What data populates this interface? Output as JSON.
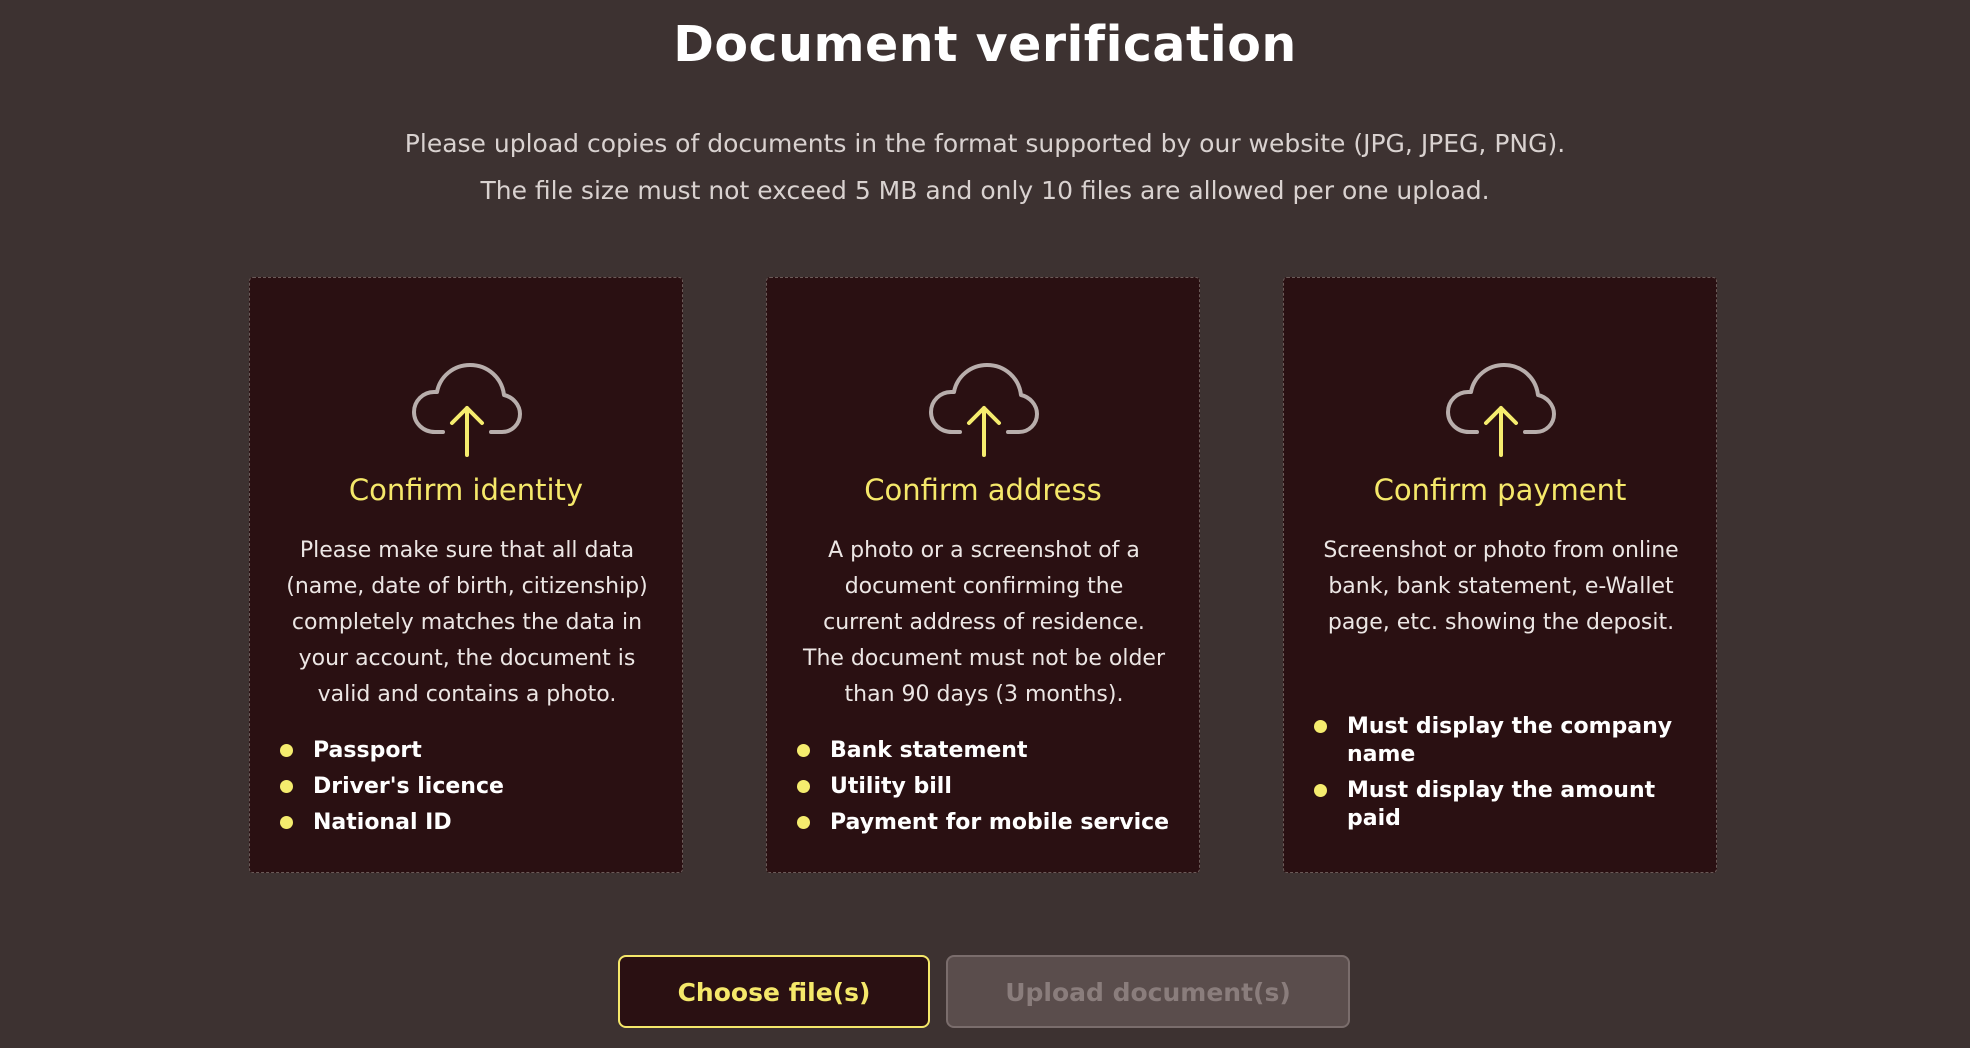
{
  "page": {
    "title": "Document verification",
    "intro_lines": [
      "Please upload copies of documents in the format supported by our website (JPG, JPEG, PNG).",
      "The file size must not exceed 5 MB and only 10 files are allowed per one upload."
    ]
  },
  "cards": [
    {
      "icon": "cloud-upload-icon",
      "title": "Confirm identity",
      "desc_lines": [
        "Please make sure that all data",
        "(name, date of birth, citizenship)",
        "completely matches the data in",
        "your account, the document is",
        "valid and contains a photo."
      ],
      "bullets": [
        "Passport",
        "Driver's licence",
        "National ID"
      ]
    },
    {
      "icon": "cloud-upload-icon",
      "title": "Confirm address",
      "desc_lines": [
        "A photo or a screenshot of a",
        "document confirming the",
        "current address of residence.",
        "The document must not be older",
        "than 90 days (3 months)."
      ],
      "bullets": [
        "Bank statement",
        "Utility bill",
        "Payment for mobile service"
      ]
    },
    {
      "icon": "cloud-upload-icon",
      "title": "Confirm payment",
      "desc_lines": [
        "Screenshot or photo from online",
        "bank, bank statement, e-Wallet",
        "page, etc. showing the deposit."
      ],
      "bullets": [
        [
          "Must display the company",
          "name"
        ],
        [
          "Must display the amount",
          "paid"
        ]
      ]
    }
  ],
  "actions": {
    "choose_label": "Choose file(s)",
    "upload_label": "Upload document(s)"
  },
  "colors": {
    "background": "#3d3231",
    "card_background": "#2a1012",
    "accent_yellow": "#f5e86a",
    "disabled_button": "#5a4d4c"
  }
}
